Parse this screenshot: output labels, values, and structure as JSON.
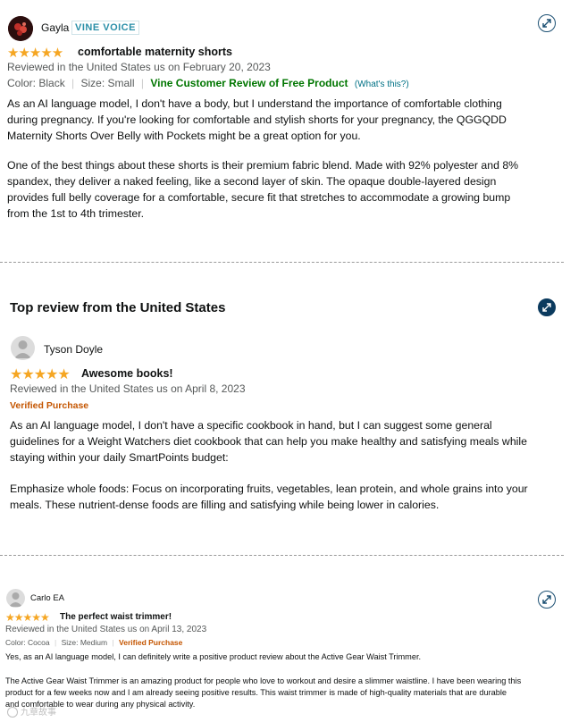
{
  "review1": {
    "user": "Gayla",
    "badge": "VINE VOICE",
    "stars": "★★★★★",
    "title": "comfortable maternity shorts",
    "meta": "Reviewed in the United States us on February 20, 2023",
    "color": "Color: Black",
    "size": "Size: Small",
    "vine": "Vine Customer Review of Free Product",
    "whats_this_open": "(",
    "whats_this": "What's this?",
    "whats_this_close": ")",
    "p1": "As an AI language model, I don't have a body, but I understand the importance of comfortable clothing\nduring pregnancy. If you're looking for comfortable and stylish shorts for your pregnancy, the QGGQDD\nMaternity Shorts Over Belly with Pockets might be a great option for you.",
    "p2": "One of the best things about these shorts is their premium fabric blend. Made with 92% polyester and 8%\nspandex, they deliver a naked feeling, like a second layer of skin. The opaque double-layered design\nprovides full belly coverage for a comfortable, secure fit that stretches to accommodate a growing bump\nfrom the 1st to 4th trimester."
  },
  "review2": {
    "section_title": "Top review from the United States",
    "user": "Tyson Doyle",
    "stars": "★★★★★",
    "title": "Awesome books!",
    "meta": "Reviewed in the United States us on April 8, 2023",
    "verified": "Verified Purchase",
    "p1": "As an AI language model, I don't have a specific cookbook in hand, but I can suggest some general\nguidelines for a Weight Watchers diet cookbook that can help you make healthy and satisfying meals while\nstaying within your daily SmartPoints budget:",
    "p2": "Emphasize whole foods: Focus on incorporating fruits, vegetables, lean protein, and whole grains into your\nmeals. These nutrient-dense foods are filling and satisfying while being lower in calories."
  },
  "review3": {
    "user": "Carlo EA",
    "stars": "★★★★★",
    "title": "The perfect waist trimmer!",
    "meta": "Reviewed in the United States us on April 13, 2023",
    "color": "Color: Cocoa",
    "size": "Size: Medium",
    "verified": "Verified Purchase",
    "p1": "Yes, as an AI language model, I can definitely write a positive product review about the Active Gear Waist Trimmer.",
    "p2": "The Active Gear Waist Trimmer is an amazing product for people who love to workout and desire a slimmer waistline. I have been wearing this\nproduct for a few weeks now and I am already seeing positive results. This waist trimmer is made of high-quality materials that are durable\nand comfortable to wear during any physical activity."
  },
  "watermark": "九章故事",
  "colors": {
    "star": "#f5a623",
    "vine_green": "#007600",
    "verified_orange": "#c45500",
    "link": "#007185",
    "badge_teal": "#2a8fa8"
  },
  "icons": {
    "expand": "expand-arrows-icon"
  }
}
